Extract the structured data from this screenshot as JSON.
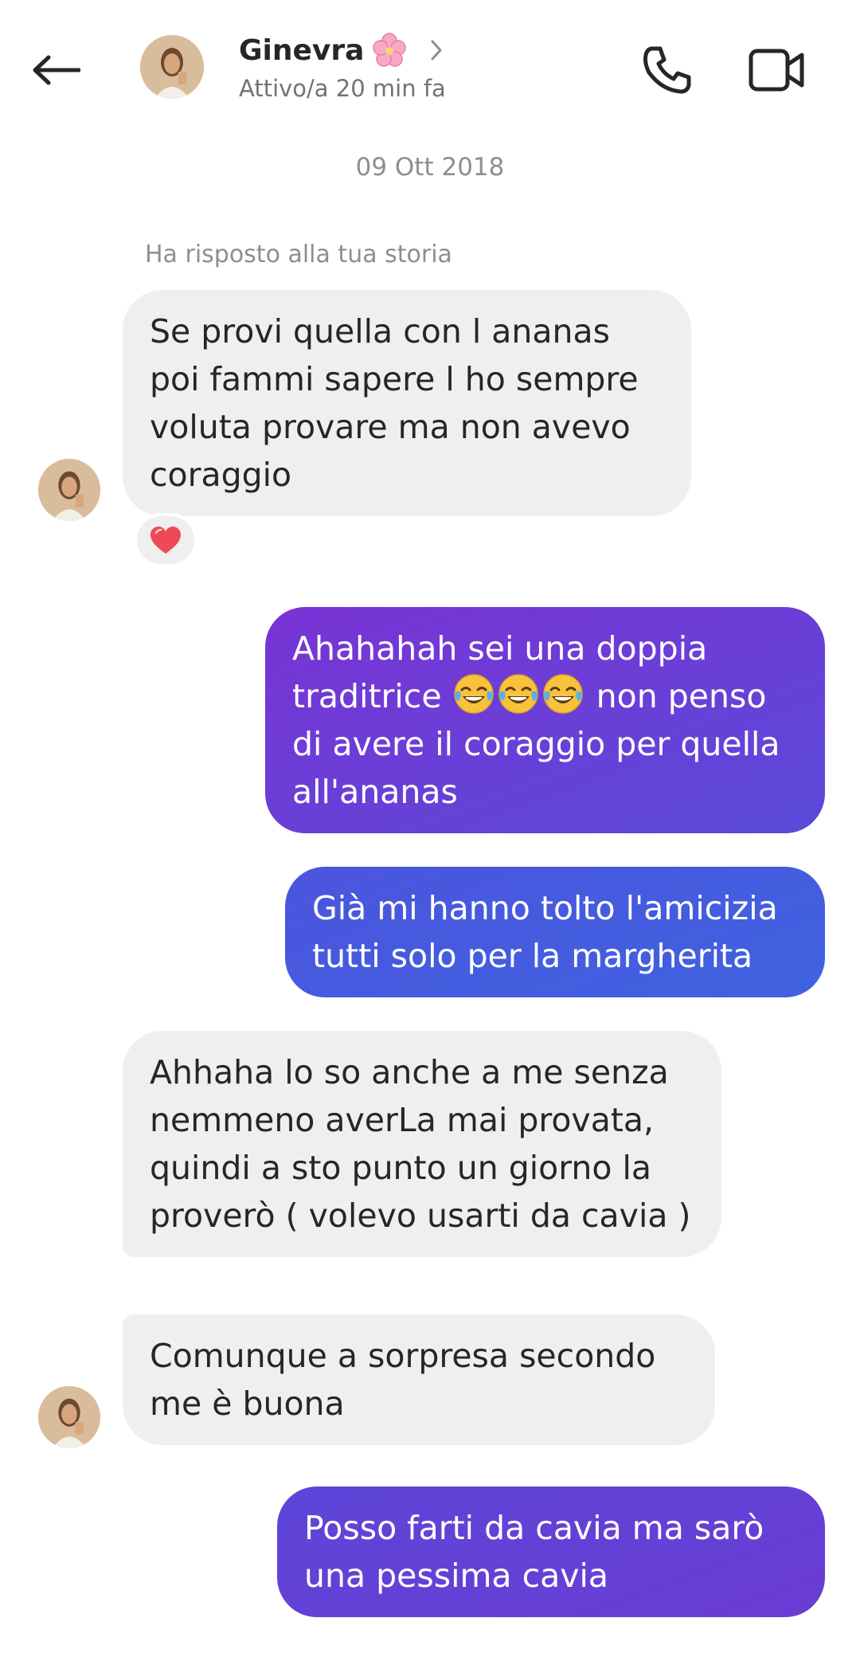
{
  "header": {
    "name": "Ginevra",
    "name_emoji": "🌸",
    "status": "Attivo/a 20 min fa",
    "icons": [
      "back-arrow-icon",
      "chevron-right-icon",
      "phone-icon",
      "video-camera-icon"
    ]
  },
  "conversation": {
    "date": "09 Ott 2018",
    "story_reply_note": "Ha risposto alla tua storia",
    "messages": [
      {
        "from": "them",
        "text": "Se provi quella con l ananas poi fammi sapere l ho sempre voluta provare ma non avevo coraggio",
        "reaction": "❤️"
      },
      {
        "from": "me",
        "text_before": "Ahahahah sei una doppia traditrice ",
        "emojis": "😂😂😂",
        "text_after": " non penso di avere il coraggio per quella all'ananas"
      },
      {
        "from": "me",
        "text": "Già mi hanno tolto l'amicizia tutti solo per la margherita"
      },
      {
        "from": "them",
        "text": "Ahhaha lo so anche a me senza nemmeno averLa mai provata, quindi a sto punto un giorno la proverò ( volevo usarti da cavia )"
      },
      {
        "from": "them",
        "text": "Comunque a sorpresa secondo me è buona"
      },
      {
        "from": "me",
        "text": "Posso farti da cavia ma sarò una pessima cavia"
      }
    ]
  },
  "colors": {
    "incoming_bubble": "#efefef",
    "outgoing_purple": "#7a33d6",
    "outgoing_blue": "#3f62e0",
    "secondary_text": "#8e8e8e"
  }
}
